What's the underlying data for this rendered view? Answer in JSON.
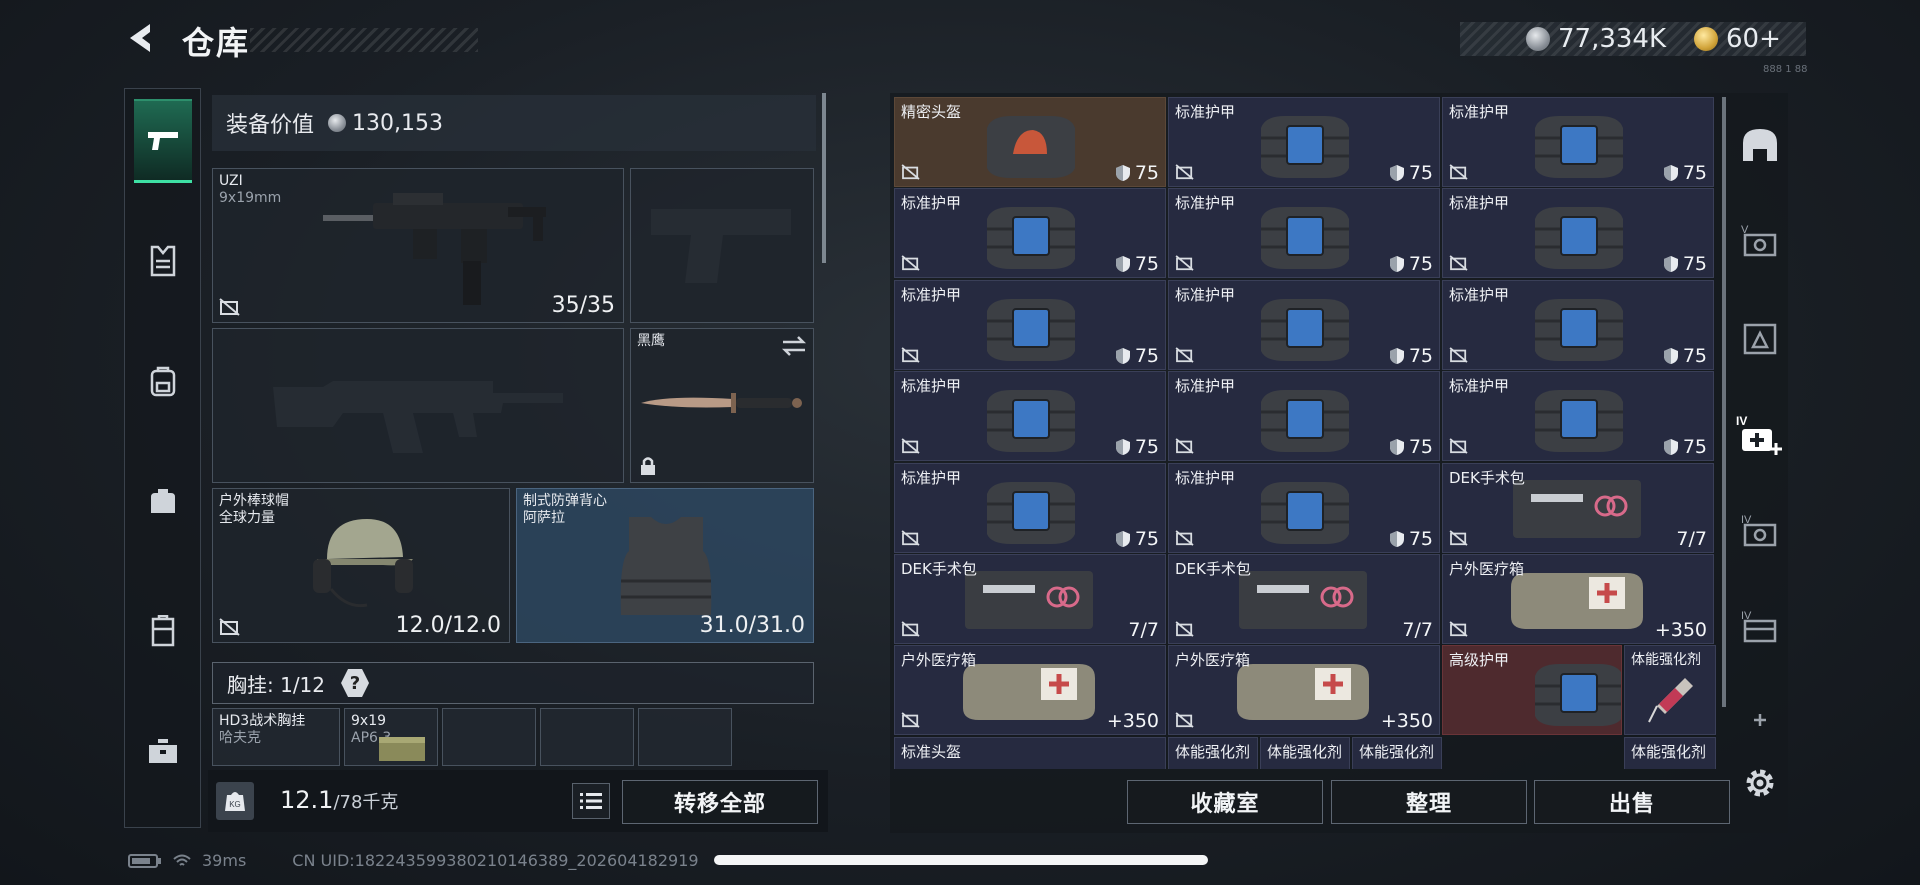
{
  "header": {
    "title": "仓库",
    "currency_silver": "77,334K",
    "currency_gold": "60+",
    "tiny_note": "888 1 88"
  },
  "nav": [
    "pistol-icon",
    "vest-icon",
    "backpack-icon",
    "bag-icon",
    "case-icon",
    "toolbox-icon"
  ],
  "equip": {
    "value_label": "装备价值",
    "value": "130,153",
    "primary": {
      "name": "UZI",
      "ammo_type": "9x19mm",
      "ammo": "35/35"
    },
    "melee": {
      "name": "黑鹰"
    },
    "helmet": {
      "name": "户外棒球帽",
      "sub": "全球力量",
      "durability": "12.0/12.0"
    },
    "armor": {
      "name": "制式防弹背心",
      "sub": "阿萨拉",
      "durability": "31.0/31.0"
    },
    "chest_rig_label": "胸挂: 1/12",
    "chest_items": [
      {
        "name": "HD3战术胸挂",
        "sub": "哈夫克"
      },
      {
        "name": "9x19",
        "sub": "AP6.3"
      }
    ]
  },
  "footer_left": {
    "weight_current": "12.1",
    "weight_max": "/78千克",
    "transfer_all": "转移全部"
  },
  "footer_right": {
    "collection": "收藏室",
    "sort": "整理",
    "sell": "出售"
  },
  "grid": [
    {
      "name": "精密头盔",
      "value": "75",
      "kind": "helmet"
    },
    {
      "name": "标准护甲",
      "value": "75",
      "kind": "armor"
    },
    {
      "name": "标准护甲",
      "value": "75",
      "kind": "armor"
    },
    {
      "name": "标准护甲",
      "value": "75",
      "kind": "armor"
    },
    {
      "name": "标准护甲",
      "value": "75",
      "kind": "armor"
    },
    {
      "name": "标准护甲",
      "value": "75",
      "kind": "armor"
    },
    {
      "name": "标准护甲",
      "value": "75",
      "kind": "armor"
    },
    {
      "name": "标准护甲",
      "value": "75",
      "kind": "armor"
    },
    {
      "name": "标准护甲",
      "value": "75",
      "kind": "armor"
    },
    {
      "name": "标准护甲",
      "value": "75",
      "kind": "armor"
    },
    {
      "name": "标准护甲",
      "value": "75",
      "kind": "armor"
    },
    {
      "name": "标准护甲",
      "value": "75",
      "kind": "armor"
    },
    {
      "name": "标准护甲",
      "value": "75",
      "kind": "armor"
    },
    {
      "name": "标准护甲",
      "value": "75",
      "kind": "armor"
    },
    {
      "name": "DEK手术包",
      "value": "7/7",
      "kind": "kit"
    },
    {
      "name": "DEK手术包",
      "value": "7/7",
      "kind": "kit"
    },
    {
      "name": "DEK手术包",
      "value": "7/7",
      "kind": "kit"
    },
    {
      "name": "户外医疗箱",
      "value": "+350",
      "kind": "medbox"
    },
    {
      "name": "户外医疗箱",
      "value": "+350",
      "kind": "medbox"
    },
    {
      "name": "户外医疗箱",
      "value": "+350",
      "kind": "medbox"
    },
    {
      "name": "高级护甲",
      "value": "",
      "kind": "armor-red"
    },
    {
      "name": "标准头盔",
      "value": "",
      "kind": "partial"
    },
    {
      "name": "体能强化剂",
      "value": "",
      "kind": "partial"
    },
    {
      "name": "体能强化剂",
      "value": "",
      "kind": "partial"
    },
    {
      "name": "体能强化剂",
      "value": "",
      "kind": "partial"
    },
    {
      "name": "体能强化剂",
      "value": "",
      "kind": "partial"
    }
  ],
  "side_item": {
    "name": "体能强化剂"
  },
  "right_tabs": [
    "helmet-category-icon",
    "v-armor-icon",
    "armor-level-icon",
    "medical-iv-icon",
    "iv-armor-icon",
    "iv-bag-icon",
    "add-icon"
  ],
  "status": {
    "ping": "39ms",
    "uid": "CN UID:18224359938021014638​9_20260418​2919"
  }
}
